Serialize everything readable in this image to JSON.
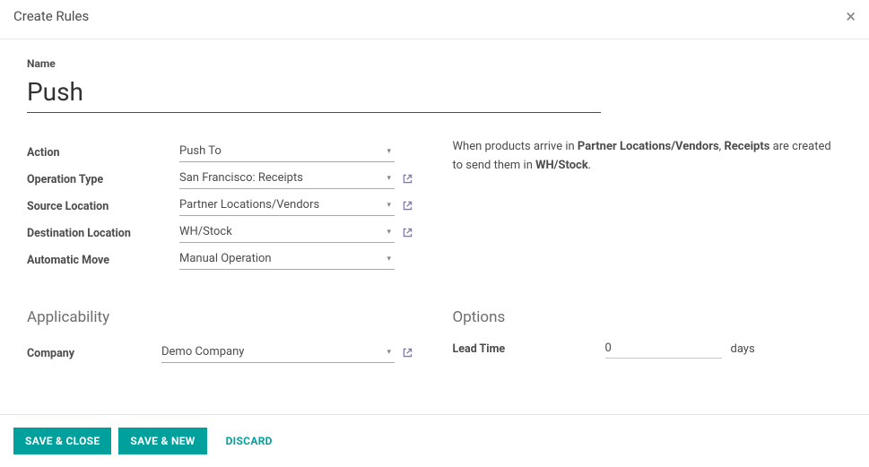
{
  "header": {
    "title": "Create Rules"
  },
  "name": {
    "label": "Name",
    "value": "Push"
  },
  "fields": {
    "action": {
      "label": "Action",
      "value": "Push To"
    },
    "op_type": {
      "label": "Operation Type",
      "value": "San Francisco: Receipts"
    },
    "src_loc": {
      "label": "Source Location",
      "value": "Partner Locations/Vendors"
    },
    "dest_loc": {
      "label": "Destination Location",
      "value": "WH/Stock"
    },
    "auto_move": {
      "label": "Automatic Move",
      "value": "Manual Operation"
    }
  },
  "help": {
    "t1": "When products arrive in ",
    "b1": "Partner Locations/Vendors",
    "t2": ", ",
    "b2": "Receipts",
    "t3": " are created to send them in ",
    "b3": "WH/Stock",
    "t4": "."
  },
  "sections": {
    "applicability": "Applicability",
    "options": "Options"
  },
  "company": {
    "label": "Company",
    "value": "Demo Company"
  },
  "lead_time": {
    "label": "Lead Time",
    "value": "0",
    "unit": "days"
  },
  "buttons": {
    "save_close": "SAVE & CLOSE",
    "save_new": "SAVE & NEW",
    "discard": "DISCARD"
  }
}
